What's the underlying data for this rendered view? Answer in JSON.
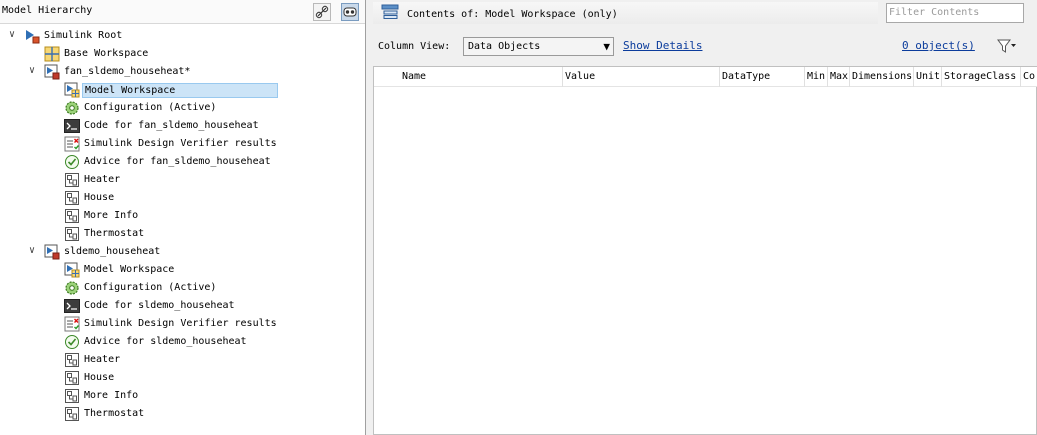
{
  "left_pane": {
    "title": "Model Hierarchy",
    "tree": [
      {
        "label": "Simulink Root",
        "icon": "simulink-root-icon",
        "level": 0,
        "expanded": true
      },
      {
        "label": "Base Workspace",
        "icon": "workspace-icon",
        "level": 1
      },
      {
        "label": "fan_sldemo_househeat*",
        "icon": "model-icon",
        "level": 1,
        "expanded": true
      },
      {
        "label": "Model Workspace",
        "icon": "model-workspace-icon",
        "level": 2,
        "selected": true
      },
      {
        "label": "Configuration (Active)",
        "icon": "configuration-icon",
        "level": 2
      },
      {
        "label": "Code for fan_sldemo_househeat",
        "icon": "code-icon",
        "level": 2
      },
      {
        "label": "Simulink Design Verifier results",
        "icon": "verifier-icon",
        "level": 2
      },
      {
        "label": "Advice for fan_sldemo_househeat",
        "icon": "advice-icon",
        "level": 2
      },
      {
        "label": "Heater",
        "icon": "subsystem-icon",
        "level": 2
      },
      {
        "label": "House",
        "icon": "subsystem-icon",
        "level": 2
      },
      {
        "label": "More Info",
        "icon": "subsystem-icon",
        "level": 2
      },
      {
        "label": "Thermostat",
        "icon": "subsystem-icon",
        "level": 2
      },
      {
        "label": "sldemo_househeat",
        "icon": "model-icon",
        "level": 1,
        "expanded": true
      },
      {
        "label": "Model Workspace",
        "icon": "model-workspace-icon",
        "level": 2
      },
      {
        "label": "Configuration (Active)",
        "icon": "configuration-icon",
        "level": 2
      },
      {
        "label": "Code for sldemo_househeat",
        "icon": "code-icon",
        "level": 2
      },
      {
        "label": "Simulink Design Verifier results",
        "icon": "verifier-icon",
        "level": 2
      },
      {
        "label": "Advice for sldemo_househeat",
        "icon": "advice-icon",
        "level": 2
      },
      {
        "label": "Heater",
        "icon": "subsystem-icon",
        "level": 2
      },
      {
        "label": "House",
        "icon": "subsystem-icon",
        "level": 2
      },
      {
        "label": "More Info",
        "icon": "subsystem-icon",
        "level": 2
      },
      {
        "label": "Thermostat",
        "icon": "subsystem-icon",
        "level": 2
      }
    ]
  },
  "right_pane": {
    "contents_title": "Contents of: Model Workspace (only)",
    "filter_placeholder": "Filter Contents",
    "column_view_label": "Column View:",
    "column_view_value": "Data Objects",
    "show_details": "Show Details",
    "object_count": "0 object(s)",
    "columns": [
      "Name",
      "Value",
      "DataType",
      "Min",
      "Max",
      "Dimensions",
      "Unit",
      "StorageClass",
      "Co"
    ]
  },
  "colors": {
    "selection": "#cce4f7",
    "link": "#0b3c9c",
    "model_red": "#c0392b",
    "simulink_blue": "#2f6fb5"
  }
}
